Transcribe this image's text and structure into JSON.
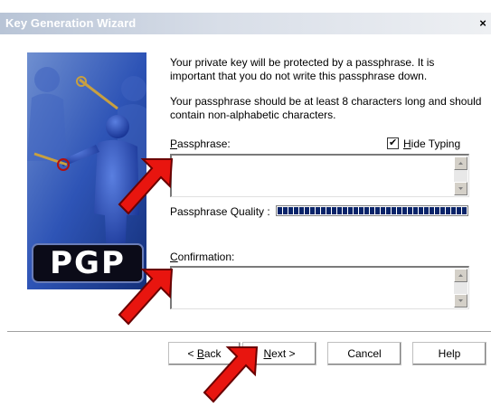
{
  "window": {
    "title": "Key Generation Wizard",
    "close_label": "×"
  },
  "intro": {
    "line1": "Your private key will be protected by a passphrase.  It is important that you do not write this passphrase down.",
    "line2": "Your passphrase should be at least 8 characters long and should contain non-alphabetic characters."
  },
  "passphrase": {
    "label_first": "P",
    "label_rest": "assphrase:",
    "value": "",
    "hide_typing_first": "H",
    "hide_typing_rest": "ide Typing",
    "hide_typing_checked": true,
    "check_mark": "✔"
  },
  "quality": {
    "label": "Passphrase Quality :",
    "level": 1.0
  },
  "confirmation": {
    "label_first": "C",
    "label_rest": "onfirmation:",
    "value": ""
  },
  "logo": {
    "text": "PGP"
  },
  "buttons": {
    "back_prefix": "< ",
    "back_first": "B",
    "back_rest": "ack",
    "next_first": "N",
    "next_rest": "ext >",
    "cancel": "Cancel",
    "help": "Help"
  },
  "colors": {
    "arrow": "#e8150f",
    "quality_bar": "#0a246a"
  }
}
